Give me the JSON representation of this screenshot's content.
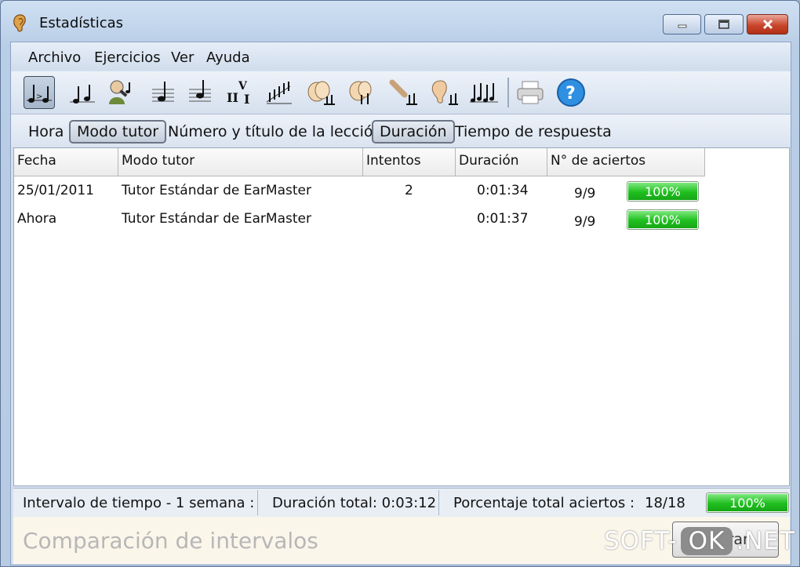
{
  "window": {
    "title": "Estadísticas"
  },
  "menu": [
    "Archivo",
    "Ejercicios",
    "Ver",
    "Ayuda"
  ],
  "toolbar": {
    "tools": [
      {
        "icon": "rhythm-compare-icon"
      },
      {
        "icon": "rhythm-notes-icon"
      },
      {
        "icon": "singer-icon"
      },
      {
        "icon": "single-note-icon"
      },
      {
        "icon": "single-note-flat-icon"
      },
      {
        "icon": "chord-degrees-icon"
      },
      {
        "icon": "scale-steps-icon"
      },
      {
        "icon": "clapping-hands-icon"
      },
      {
        "icon": "clapping-hands-2-icon"
      },
      {
        "icon": "tapping-hand-icon"
      },
      {
        "icon": "ear-icon"
      },
      {
        "icon": "multiple-notes-icon"
      },
      {
        "icon": "printer-icon"
      },
      {
        "icon": "help-icon"
      }
    ]
  },
  "columns_bar": [
    {
      "label": "Hora",
      "selected": false
    },
    {
      "label": "Modo tutor",
      "selected": true
    },
    {
      "label": "Número y título de la lección",
      "selected": false
    },
    {
      "label": "Duración",
      "selected": true
    },
    {
      "label": "Tiempo de respuesta",
      "selected": false
    }
  ],
  "table": {
    "headers": [
      "Fecha",
      "Modo tutor",
      "Intentos",
      "Duración",
      "N° de aciertos"
    ],
    "rows": [
      {
        "fecha": "25/01/2011",
        "modo": "Tutor Estándar de EarMaster",
        "intentos": "2",
        "duracion": "0:01:34",
        "aciertos": "9/9",
        "porcentaje": "100%",
        "progress": 1.0
      },
      {
        "fecha": "Ahora",
        "modo": "Tutor Estándar de EarMaster",
        "intentos": "",
        "duracion": "0:01:37",
        "aciertos": "9/9",
        "porcentaje": "100%",
        "progress": 1.0
      }
    ]
  },
  "status": {
    "interval": "Intervalo de tiempo - 1 semana :",
    "total_duration": "Duración total: 0:03:12",
    "total_label": "Porcentaje total aciertos :",
    "total_value": "18/18",
    "total_percent": "100%",
    "total_progress": 1.0
  },
  "bottom": {
    "exercise": "Comparación de intervalos",
    "close_button": "Cerrar"
  },
  "watermark": {
    "a": "SOFT-",
    "b": "OK",
    "c": ".NET"
  }
}
